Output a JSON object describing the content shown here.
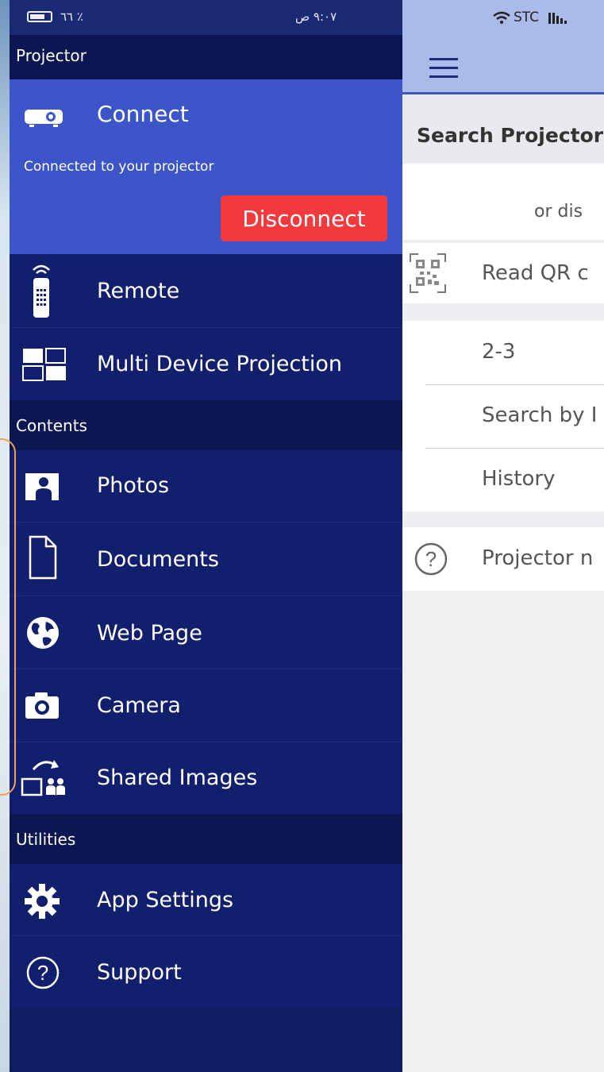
{
  "status_bar": {
    "battery_text": "٦٦ ٪",
    "clock_text": "٩:٠٧ ص",
    "carrier_text": "STC"
  },
  "drawer": {
    "projector_header": "Projector",
    "connect": {
      "title": "Connect",
      "status_text": "Connected to your projector",
      "disconnect_label": "Disconnect"
    },
    "projector_items": [
      {
        "label": "Remote",
        "icon": "remote-icon"
      },
      {
        "label": "Multi Device Projection",
        "icon": "multi-device-icon"
      }
    ],
    "contents_header": "Contents",
    "contents_items": [
      {
        "label": "Photos",
        "icon": "photo-icon"
      },
      {
        "label": "Documents",
        "icon": "document-icon"
      },
      {
        "label": "Web Page",
        "icon": "globe-icon"
      },
      {
        "label": "Camera",
        "icon": "camera-icon"
      },
      {
        "label": "Shared Images",
        "icon": "shared-images-icon"
      }
    ],
    "utilities_header": "Utilities",
    "utilities_items": [
      {
        "label": "App Settings",
        "icon": "gear-icon"
      },
      {
        "label": "Support",
        "icon": "help-icon"
      }
    ]
  },
  "panel": {
    "title": "Search Projector",
    "hint": "or dis",
    "qr_label": "Read QR c",
    "list_items": [
      "2-3",
      "Search by I",
      "History"
    ],
    "help_item": "Projector n"
  },
  "colors": {
    "drawer_bg": "#121f6c",
    "section_header_bg": "#0c1752",
    "connect_bg": "#3c55c9",
    "disconnect_red": "#f03a3e",
    "topbar_blue": "#aabbe9"
  }
}
